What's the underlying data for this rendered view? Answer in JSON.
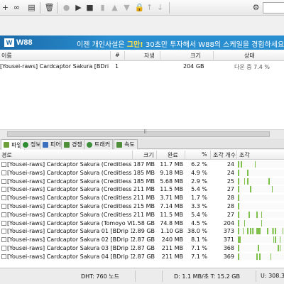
{
  "toolbar": {
    "buttons": [
      "add-torrent",
      "add-link",
      "create-torrent",
      "remove-torrent",
      "user-icon",
      "start",
      "stop",
      "up",
      "down",
      "preferences"
    ]
  },
  "ad": {
    "logo": "W88",
    "text_pre": "이젠 개인사설은 ",
    "text_bold": "그만!",
    "text_post": " 30초만 투자해서 W88의 스케일을 경험하세요"
  },
  "torrent_list": {
    "columns": {
      "name": "이름",
      "num": "#",
      "health": "자생",
      "size": "크기",
      "status": "상태"
    },
    "rows": [
      {
        "name": "[Yousei-raws] Cardcaptor Sakura [BDrip 14...",
        "num": "1",
        "size": "204 GB",
        "status": "다운 중 7.4 %"
      }
    ]
  },
  "tabs": [
    {
      "label": "파일",
      "color": "#5a8f2a"
    },
    {
      "label": "정보",
      "color": "#2a7f2a"
    },
    {
      "label": "피어",
      "color": "#3a6fbf"
    },
    {
      "label": "경쟁",
      "color": "#4f8f3a"
    },
    {
      "label": "트래커",
      "color": "#3e8e3e"
    },
    {
      "label": "속도",
      "color": "#4f8f3a"
    }
  ],
  "files": {
    "columns": {
      "path": "경로",
      "size": "크기",
      "done": "완료",
      "pct": "%",
      "pcs": "조각 개수",
      "pieces": "조각"
    },
    "rows": [
      {
        "name": "[Yousei-raws] Cardcaptor Sakura (Creditless ED 1...",
        "size": "187 MB",
        "done": "11.7 MB",
        "pct": "6.2 %",
        "pcs": "24"
      },
      {
        "name": "[Yousei-raws] Cardcaptor Sakura (Creditless ED 2...",
        "size": "185 MB",
        "done": "9.18 MB",
        "pct": "4.9 %",
        "pcs": "24"
      },
      {
        "name": "[Yousei-raws] Cardcaptor Sakura (Creditless ED 3...",
        "size": "185 MB",
        "done": "5.68 MB",
        "pct": "2.9 %",
        "pcs": "25"
      },
      {
        "name": "[Yousei-raws] Cardcaptor Sakura (Creditless OP 1...",
        "size": "211 MB",
        "done": "11.5 MB",
        "pct": "5.4 %",
        "pcs": "27"
      },
      {
        "name": "[Yousei-raws] Cardcaptor Sakura (Creditless OP 2...",
        "size": "211 MB",
        "done": "3.71 MB",
        "pct": "1.7 %",
        "pcs": "28"
      },
      {
        "name": "[Yousei-raws] Cardcaptor Sakura (Creditless OP 3...",
        "size": "215 MB",
        "done": "7.14 MB",
        "pct": "3.3 %",
        "pcs": "28"
      },
      {
        "name": "[Yousei-raws] Cardcaptor Sakura (Creditless OP 3...",
        "size": "211 MB",
        "done": "11.5 MB",
        "pct": "5.4 %",
        "pcs": "27"
      },
      {
        "name": "[Yousei-raws] Cardcaptor Sakura (Tomoyo Video ...",
        "size": "1.58 GB",
        "done": "74.8 MB",
        "pct": "4.5 %",
        "pcs": "204"
      },
      {
        "name": "[Yousei-raws] Cardcaptor Sakura 01 [BDrip 1440...",
        "size": "2.89 GB",
        "done": "1.10 GB",
        "pct": "38.0 %",
        "pcs": "373"
      },
      {
        "name": "[Yousei-raws] Cardcaptor Sakura 02 [BDrip 1440...",
        "size": "2.87 GB",
        "done": "240 MB",
        "pct": "8.1 %",
        "pcs": "371"
      },
      {
        "name": "[Yousei-raws] Cardcaptor Sakura 03 [BDrip 1440...",
        "size": "2.87 GB",
        "done": "211 MB",
        "pct": "7.1 %",
        "pcs": "368"
      },
      {
        "name": "[Yousei-raws] Cardcaptor Sakura 04 [BDrip 1440...",
        "size": "2.87 GB",
        "done": "211 MB",
        "pct": "7.1 %",
        "pcs": "369"
      }
    ]
  },
  "status": {
    "dht": "DHT: 760 노드",
    "down": "D: 1.1 MB/초 T: 15.2 GB",
    "up": "U: 308.3"
  }
}
